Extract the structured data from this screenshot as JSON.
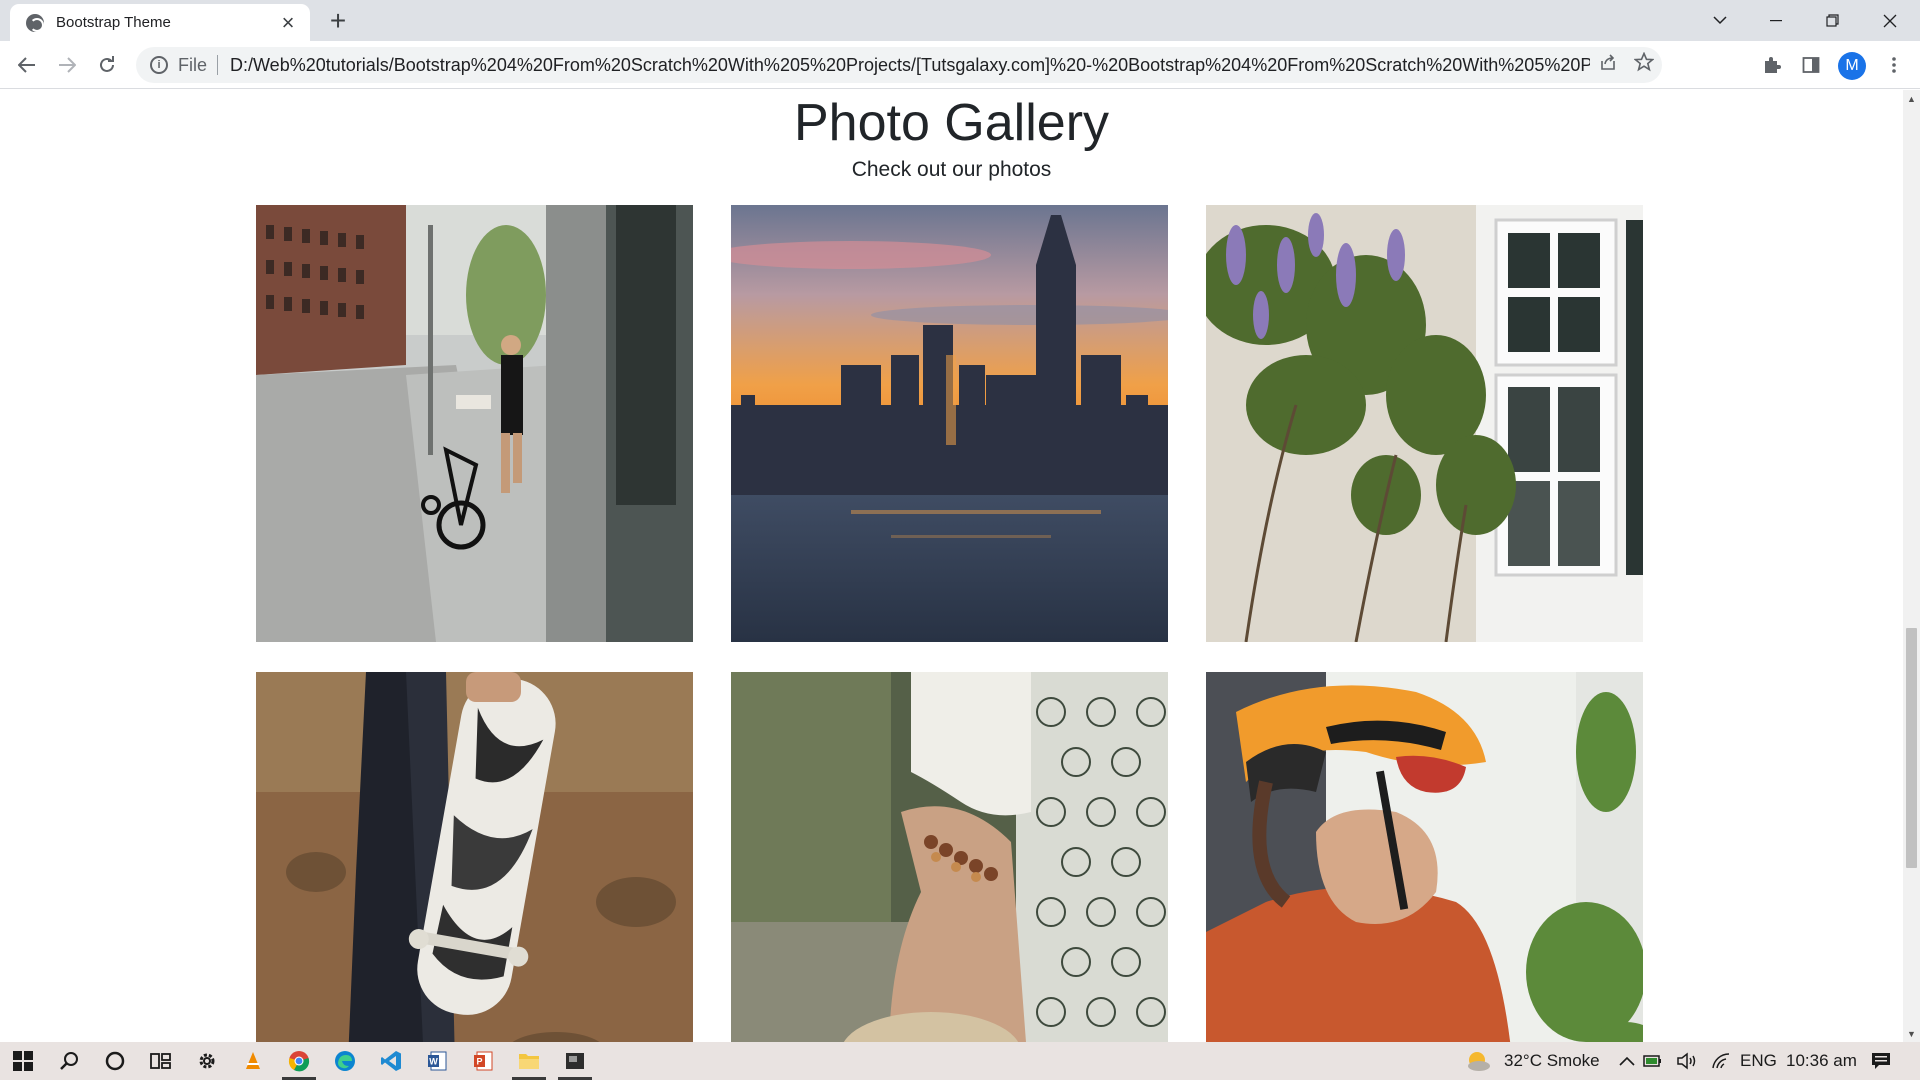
{
  "browser": {
    "tab_title": "Bootstrap Theme",
    "address_scheme": "File",
    "url": "D:/Web%20tutorials/Bootstrap%204%20From%20Scratch%20With%205%20Projects/[Tutsgalaxy.com]%20-%20Bootstrap%204%20From%20Scratch%20With%205%20Projects/09%20Pr...",
    "profile_initial": "M"
  },
  "page": {
    "title": "Photo Gallery",
    "subtitle": "Check out our photos"
  },
  "taskbar": {
    "weather": "32°C  Smoke",
    "language": "ENG",
    "time": "10:36 am"
  }
}
